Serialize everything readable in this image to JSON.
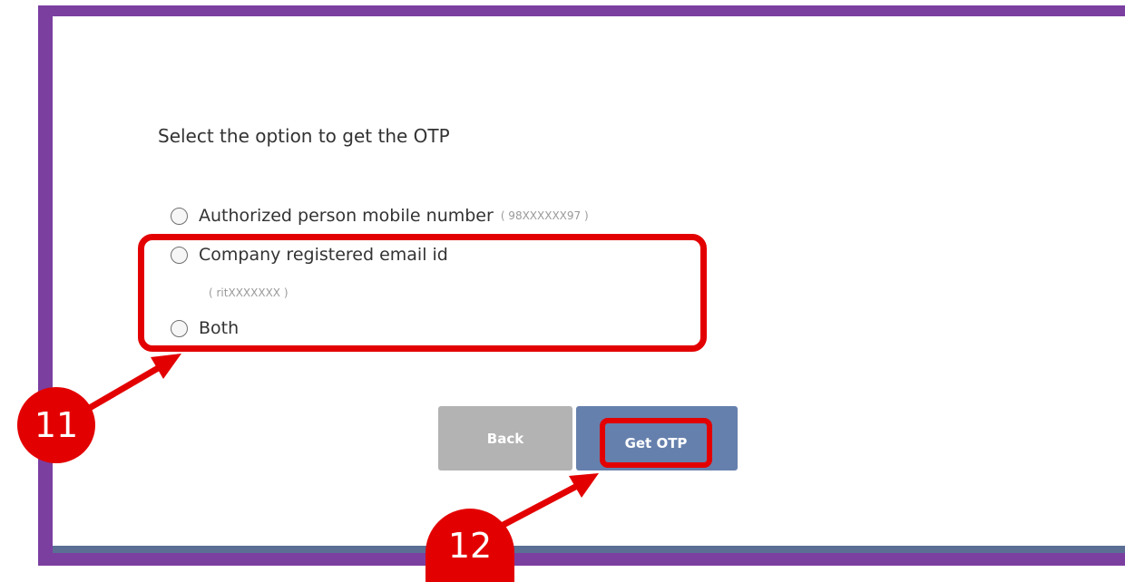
{
  "form": {
    "prompt": "Select the option to get the OTP",
    "options": [
      {
        "label": "Authorized person mobile number",
        "hint": "( 98XXXXXX97 )"
      },
      {
        "label": "Company registered email id",
        "hint": "( ritXXXXXXX )"
      },
      {
        "label": "Both"
      }
    ],
    "buttons": {
      "back": "Back",
      "get_otp": "Get OTP"
    }
  },
  "annotations": {
    "step_11": "11",
    "step_12": "12"
  },
  "colors": {
    "frame": "#7b3fa0",
    "highlight": "#e30000",
    "back_button": "#b3b3b3",
    "get_otp_button": "#6680ad"
  }
}
